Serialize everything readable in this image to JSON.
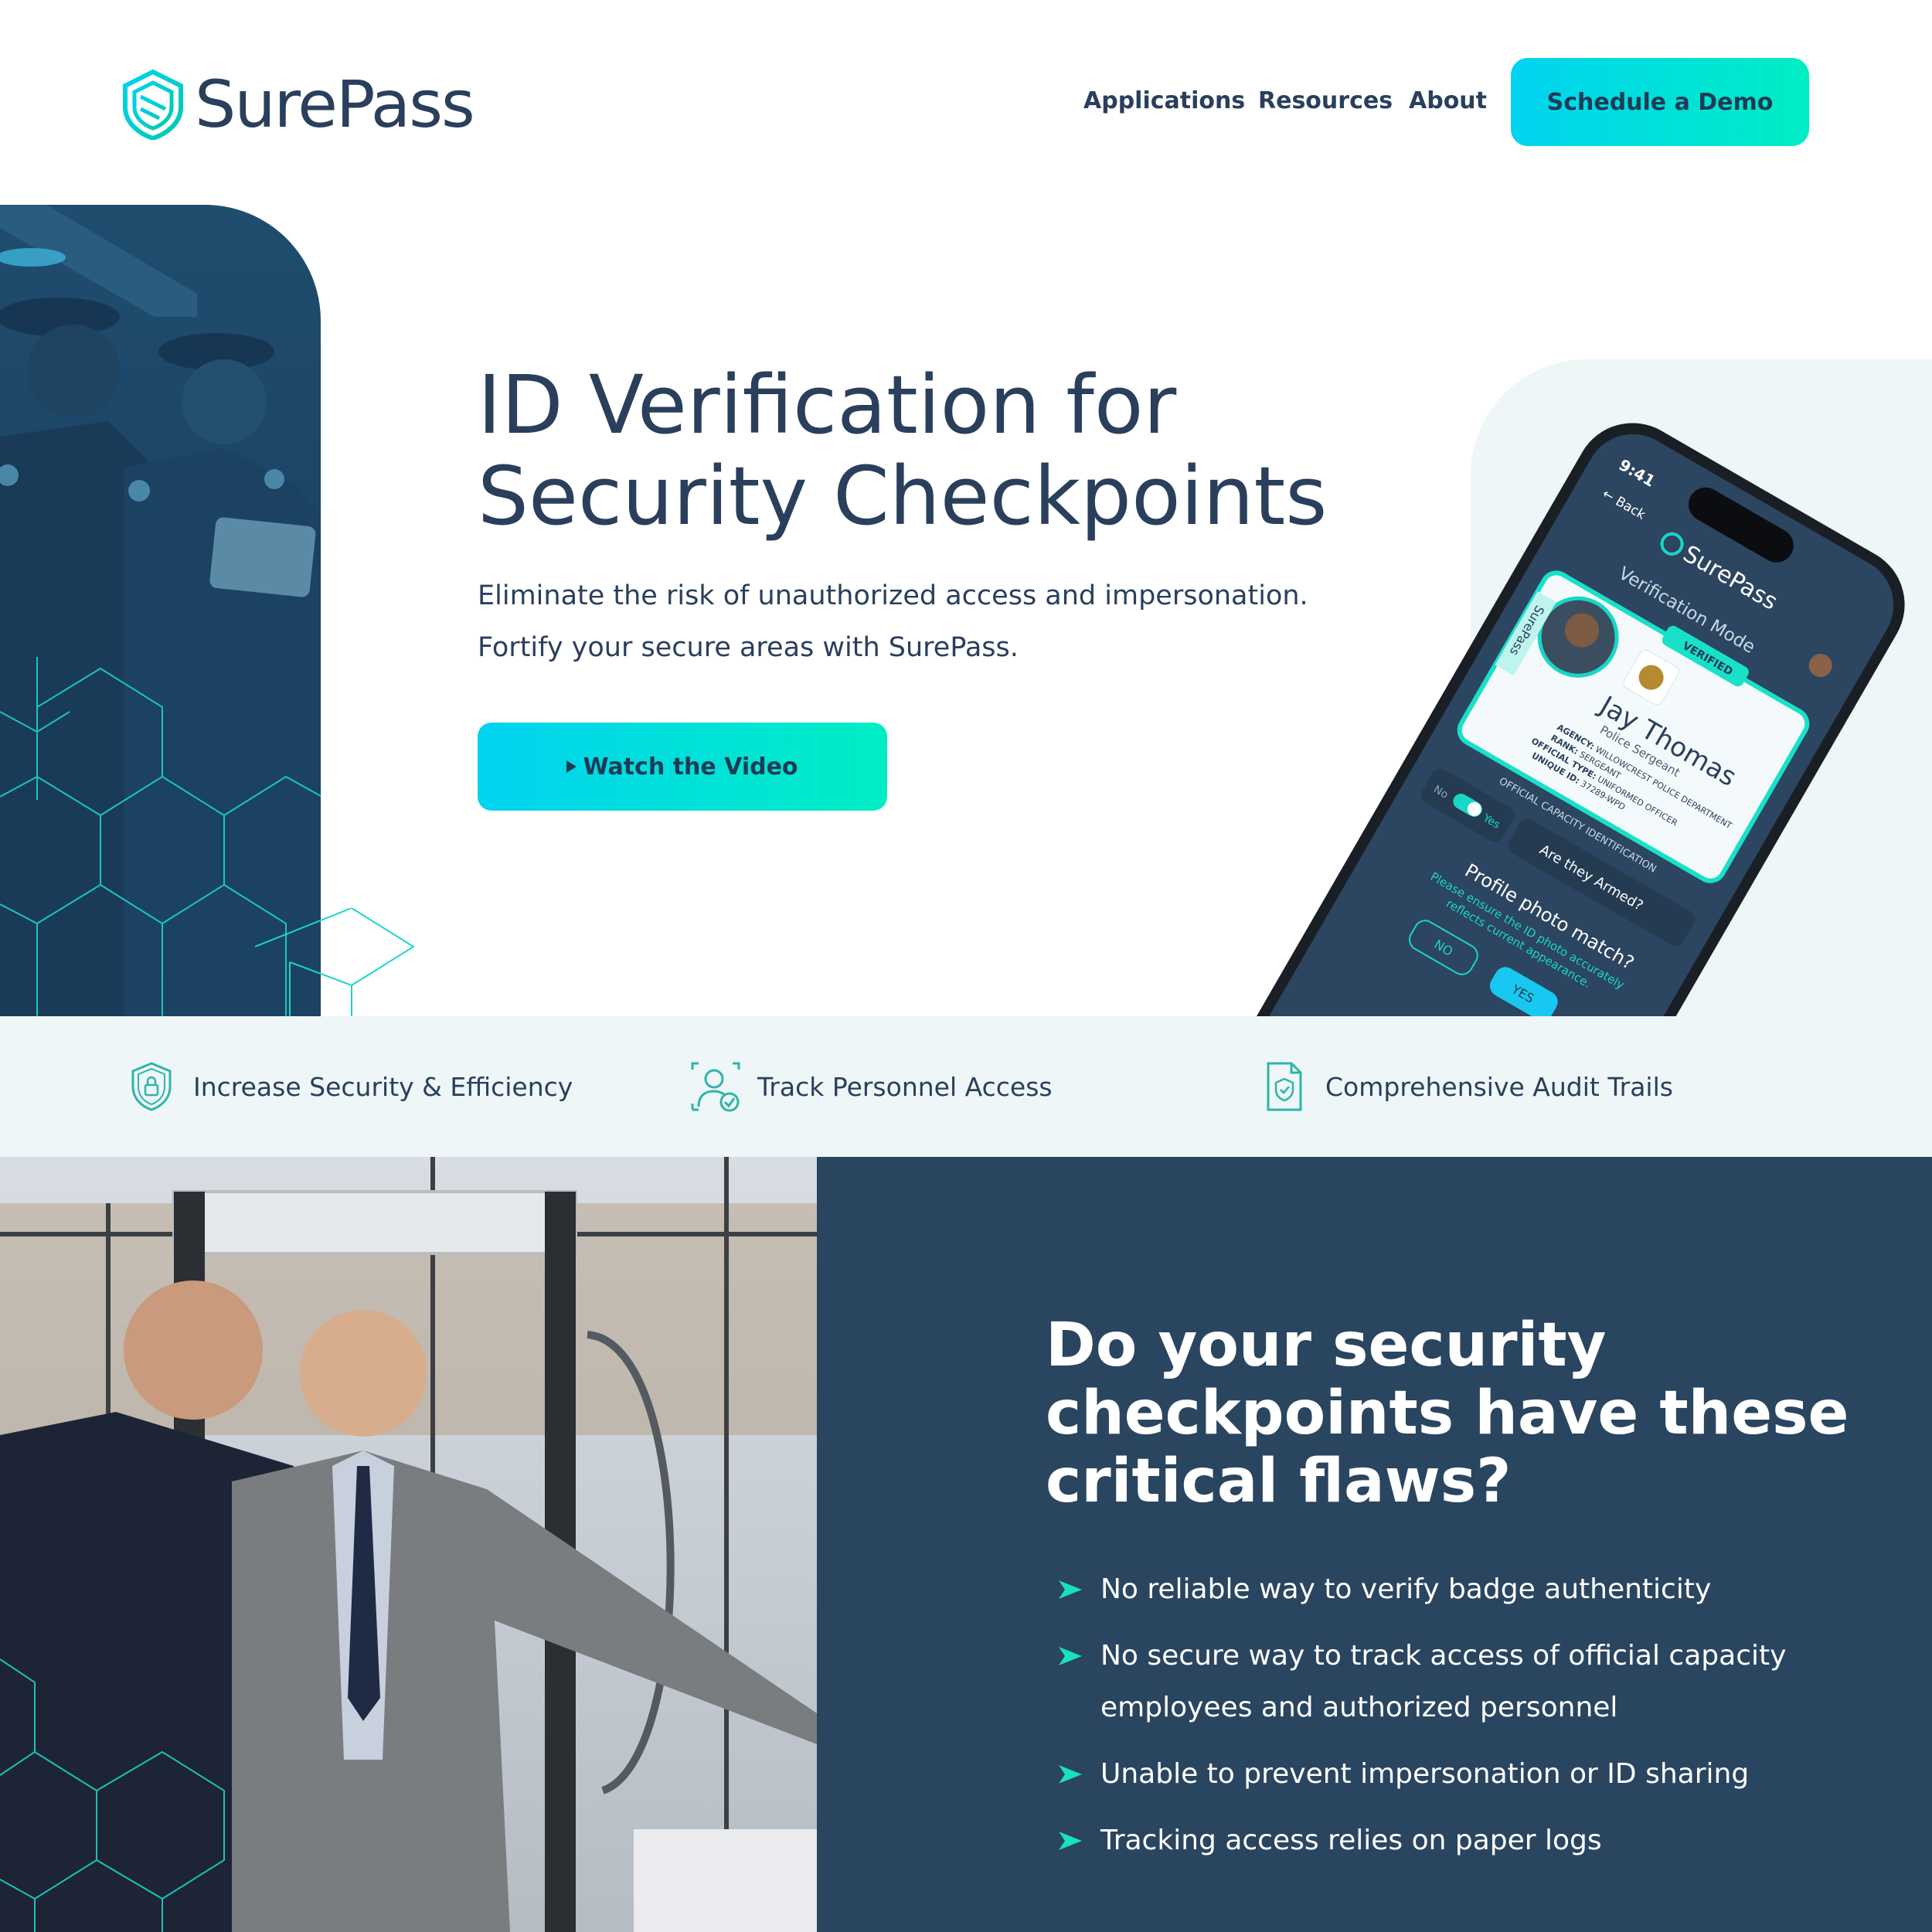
{
  "brand": {
    "name": "SurePass",
    "accent": "#00d3f0",
    "accent2": "#00edc4",
    "navy": "#2a3f5c"
  },
  "nav": {
    "items": [
      "Applications",
      "Resources",
      "About"
    ],
    "cta_label": "Schedule a Demo"
  },
  "hero": {
    "title_line1": "ID Verification for",
    "title_line2": "Security Checkpoints",
    "subtitle_line1": "Eliminate the risk of unauthorized access and impersonation.",
    "subtitle_line2": "Fortify your secure areas with SurePass.",
    "cta_label": "Watch the Video"
  },
  "phone": {
    "time": "9:41",
    "back_label": "Back",
    "app_name": "SurePass",
    "mode_title": "Verification Mode",
    "badge": "VERIFIED",
    "card_side_label": "SurePass",
    "person_name": "Jay Thomas",
    "person_title": "Police Sergeant",
    "fields": [
      {
        "label": "AGENCY:",
        "value": "WILLOWCREST POLICE DEPARTMENT"
      },
      {
        "label": "RANK:",
        "value": "SERGEANT"
      },
      {
        "label": "OFFICIAL TYPE:",
        "value": "UNIFORMED OFFICER"
      },
      {
        "label": "UNIQUE ID:",
        "value": "37289-WPD"
      }
    ],
    "card_footer": "OFFICIAL CAPACITY IDENTIFICATION",
    "toggle_no": "No",
    "toggle_yes": "Yes",
    "armed_question": "Are they Armed?",
    "match_question": "Profile photo match?",
    "match_hint_line1": "Please ensure the ID photo accurately",
    "match_hint_line2": "reflects current appearance.",
    "btn_no": "NO",
    "btn_yes": "YES"
  },
  "features": [
    {
      "icon": "shield-lock-icon",
      "label": "Increase Security & Efficiency"
    },
    {
      "icon": "user-check-icon",
      "label": "Track Personnel Access"
    },
    {
      "icon": "document-shield-icon",
      "label": "Comprehensive Audit Trails"
    }
  ],
  "flaws_section": {
    "title_line1": "Do your security",
    "title_line2": "checkpoints have these",
    "title_line3": "critical flaws?",
    "items": [
      "No reliable way to verify badge authenticity",
      "No secure way to track access of official capacity employees and authorized personnel",
      "Unable to prevent impersonation or ID sharing",
      "Tracking access relies on paper logs"
    ]
  }
}
